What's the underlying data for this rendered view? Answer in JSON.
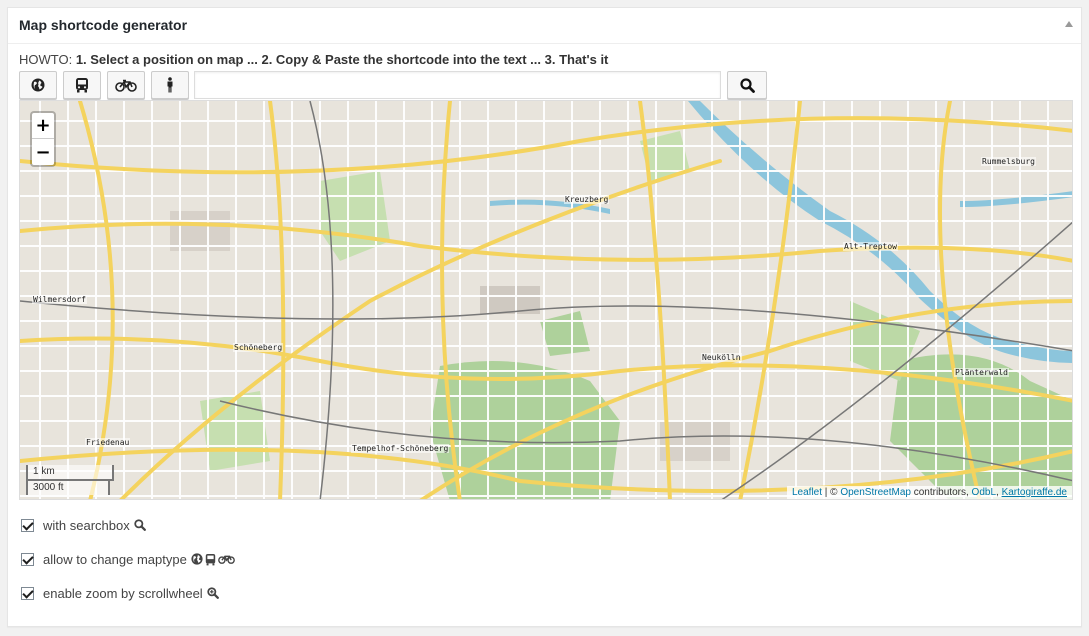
{
  "panel": {
    "title": "Map shortcode generator"
  },
  "howto": {
    "prefix": "HOWTO: ",
    "steps": "1. Select a position on map ... 2. Copy & Paste the shortcode into the text ... 3. That's it"
  },
  "toolbar": {
    "buttons": [
      {
        "name": "map-type-standard",
        "icon": "globe-icon"
      },
      {
        "name": "map-type-transport",
        "icon": "bus-icon"
      },
      {
        "name": "map-type-cycle",
        "icon": "bicycle-icon"
      },
      {
        "name": "map-type-walking",
        "icon": "pedestrian-icon"
      }
    ],
    "search_value": "",
    "search_icon": "search-icon"
  },
  "map": {
    "zoom_in": "+",
    "zoom_out": "−",
    "scale_metric": "1 km",
    "scale_imperial": "3000 ft",
    "attribution": {
      "leaflet": "Leaflet",
      "sep": " | © ",
      "osm": "OpenStreetMap",
      "contributors": " contributors, ",
      "odbl": "OdbL",
      "comma": ", ",
      "kartogiraffe": "Kartogiraffe.de"
    },
    "places": [
      "Kreuzberg",
      "Rummelsburg",
      "Alt-Treptow",
      "Wilmersdorf",
      "Schöneberg",
      "Neukölln",
      "Plänterwald",
      "Friedenau",
      "Tempelhof-Schöneberg"
    ],
    "colors": {
      "land": "#e8e4dc",
      "road_major": "#f4d35e",
      "road_minor": "#ffffff",
      "park": "#aed19b",
      "water": "#8cc5dc",
      "rail": "#777777"
    }
  },
  "options": [
    {
      "label": "with searchbox",
      "checked": true,
      "icons": [
        "search-icon"
      ]
    },
    {
      "label": "allow to change maptype",
      "checked": true,
      "icons": [
        "globe-icon",
        "bus-icon",
        "bicycle-icon"
      ]
    },
    {
      "label": "enable zoom by scrollwheel",
      "checked": true,
      "icons": [
        "zoom-in-icon"
      ]
    }
  ]
}
